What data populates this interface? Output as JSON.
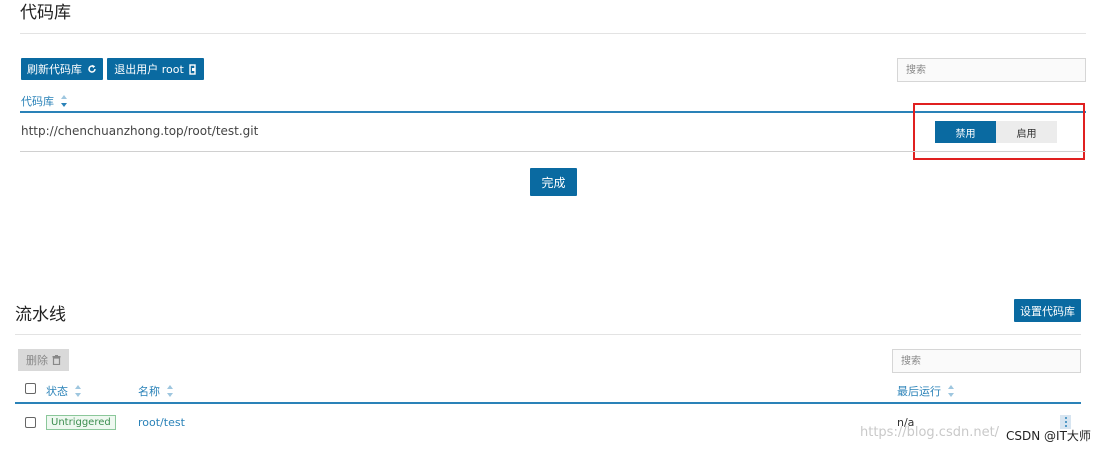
{
  "repos": {
    "title": "代码库",
    "refresh_label": "刷新代码库",
    "logout_label": "退出用户 root",
    "search_placeholder": "搜索",
    "column_header": "代码库",
    "row_url": "http://chenchuanzhong.top/root/test.git",
    "toggle_disable": "禁用",
    "toggle_enable": "启用",
    "done_label": "完成"
  },
  "pipelines": {
    "title": "流水线",
    "setup_repo_label": "设置代码库",
    "delete_label": "删除",
    "search_placeholder": "搜索",
    "columns": {
      "status": "状态",
      "name": "名称",
      "last_run": "最后运行"
    },
    "rows": [
      {
        "status": "Untriggered",
        "name": "root/test",
        "last_run": "n/a"
      }
    ]
  },
  "watermark": {
    "url": "https://blog.csdn.net/",
    "credit": "CSDN @IT大师"
  },
  "colors": {
    "primary": "#0a6aa1",
    "link": "#2a82b8",
    "highlight": "#e02020",
    "success": "#3c8d4f"
  },
  "icons": {
    "refresh": "refresh-icon",
    "logout": "logout-icon",
    "trash": "trash-icon",
    "sort": "sort-icon",
    "kebab": "kebab-menu-icon"
  }
}
